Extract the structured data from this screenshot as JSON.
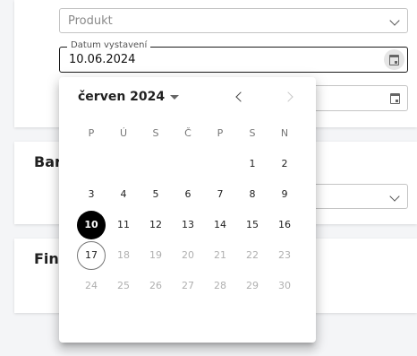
{
  "form": {
    "product_select": {
      "value": "Produkt"
    },
    "issue_date": {
      "label": "Datum vystavení",
      "value": "10.06.2024"
    }
  },
  "sections": [
    {
      "title": "Bar"
    },
    {
      "title": "Fin"
    }
  ],
  "calendar": {
    "month_label": "červen 2024",
    "weekdays": [
      "P",
      "Ú",
      "S",
      "Č",
      "P",
      "S",
      "N"
    ],
    "selected_day": 10,
    "today": 17,
    "last_enabled_day": 17,
    "days": [
      [
        null,
        null,
        null,
        null,
        null,
        1,
        2
      ],
      [
        3,
        4,
        5,
        6,
        7,
        8,
        9
      ],
      [
        10,
        11,
        12,
        13,
        14,
        15,
        16
      ],
      [
        17,
        18,
        19,
        20,
        21,
        22,
        23
      ],
      [
        24,
        25,
        26,
        27,
        28,
        29,
        30
      ]
    ]
  }
}
